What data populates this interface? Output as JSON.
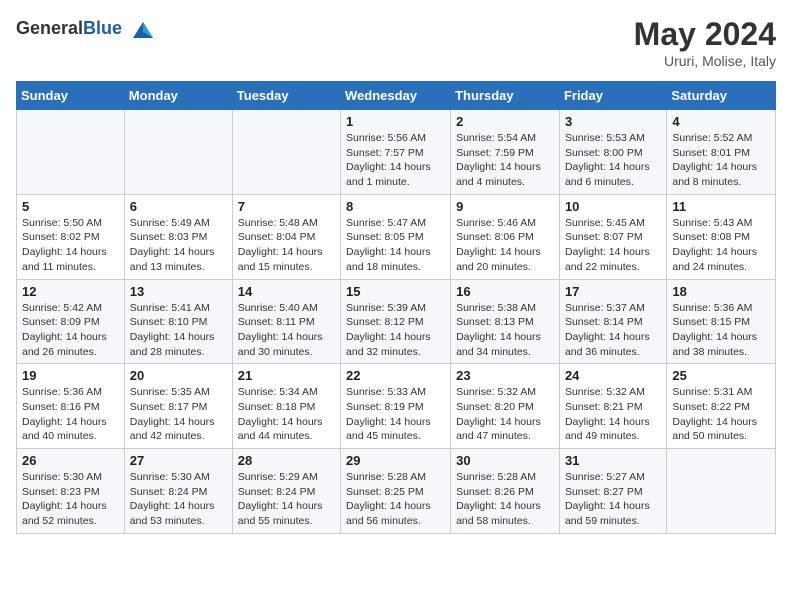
{
  "header": {
    "logo_general": "General",
    "logo_blue": "Blue",
    "month_year": "May 2024",
    "location": "Ururi, Molise, Italy"
  },
  "weekdays": [
    "Sunday",
    "Monday",
    "Tuesday",
    "Wednesday",
    "Thursday",
    "Friday",
    "Saturday"
  ],
  "weeks": [
    [
      {
        "day": "",
        "sunrise": "",
        "sunset": "",
        "daylight": ""
      },
      {
        "day": "",
        "sunrise": "",
        "sunset": "",
        "daylight": ""
      },
      {
        "day": "",
        "sunrise": "",
        "sunset": "",
        "daylight": ""
      },
      {
        "day": "1",
        "sunrise": "Sunrise: 5:56 AM",
        "sunset": "Sunset: 7:57 PM",
        "daylight": "Daylight: 14 hours and 1 minute."
      },
      {
        "day": "2",
        "sunrise": "Sunrise: 5:54 AM",
        "sunset": "Sunset: 7:59 PM",
        "daylight": "Daylight: 14 hours and 4 minutes."
      },
      {
        "day": "3",
        "sunrise": "Sunrise: 5:53 AM",
        "sunset": "Sunset: 8:00 PM",
        "daylight": "Daylight: 14 hours and 6 minutes."
      },
      {
        "day": "4",
        "sunrise": "Sunrise: 5:52 AM",
        "sunset": "Sunset: 8:01 PM",
        "daylight": "Daylight: 14 hours and 8 minutes."
      }
    ],
    [
      {
        "day": "5",
        "sunrise": "Sunrise: 5:50 AM",
        "sunset": "Sunset: 8:02 PM",
        "daylight": "Daylight: 14 hours and 11 minutes."
      },
      {
        "day": "6",
        "sunrise": "Sunrise: 5:49 AM",
        "sunset": "Sunset: 8:03 PM",
        "daylight": "Daylight: 14 hours and 13 minutes."
      },
      {
        "day": "7",
        "sunrise": "Sunrise: 5:48 AM",
        "sunset": "Sunset: 8:04 PM",
        "daylight": "Daylight: 14 hours and 15 minutes."
      },
      {
        "day": "8",
        "sunrise": "Sunrise: 5:47 AM",
        "sunset": "Sunset: 8:05 PM",
        "daylight": "Daylight: 14 hours and 18 minutes."
      },
      {
        "day": "9",
        "sunrise": "Sunrise: 5:46 AM",
        "sunset": "Sunset: 8:06 PM",
        "daylight": "Daylight: 14 hours and 20 minutes."
      },
      {
        "day": "10",
        "sunrise": "Sunrise: 5:45 AM",
        "sunset": "Sunset: 8:07 PM",
        "daylight": "Daylight: 14 hours and 22 minutes."
      },
      {
        "day": "11",
        "sunrise": "Sunrise: 5:43 AM",
        "sunset": "Sunset: 8:08 PM",
        "daylight": "Daylight: 14 hours and 24 minutes."
      }
    ],
    [
      {
        "day": "12",
        "sunrise": "Sunrise: 5:42 AM",
        "sunset": "Sunset: 8:09 PM",
        "daylight": "Daylight: 14 hours and 26 minutes."
      },
      {
        "day": "13",
        "sunrise": "Sunrise: 5:41 AM",
        "sunset": "Sunset: 8:10 PM",
        "daylight": "Daylight: 14 hours and 28 minutes."
      },
      {
        "day": "14",
        "sunrise": "Sunrise: 5:40 AM",
        "sunset": "Sunset: 8:11 PM",
        "daylight": "Daylight: 14 hours and 30 minutes."
      },
      {
        "day": "15",
        "sunrise": "Sunrise: 5:39 AM",
        "sunset": "Sunset: 8:12 PM",
        "daylight": "Daylight: 14 hours and 32 minutes."
      },
      {
        "day": "16",
        "sunrise": "Sunrise: 5:38 AM",
        "sunset": "Sunset: 8:13 PM",
        "daylight": "Daylight: 14 hours and 34 minutes."
      },
      {
        "day": "17",
        "sunrise": "Sunrise: 5:37 AM",
        "sunset": "Sunset: 8:14 PM",
        "daylight": "Daylight: 14 hours and 36 minutes."
      },
      {
        "day": "18",
        "sunrise": "Sunrise: 5:36 AM",
        "sunset": "Sunset: 8:15 PM",
        "daylight": "Daylight: 14 hours and 38 minutes."
      }
    ],
    [
      {
        "day": "19",
        "sunrise": "Sunrise: 5:36 AM",
        "sunset": "Sunset: 8:16 PM",
        "daylight": "Daylight: 14 hours and 40 minutes."
      },
      {
        "day": "20",
        "sunrise": "Sunrise: 5:35 AM",
        "sunset": "Sunset: 8:17 PM",
        "daylight": "Daylight: 14 hours and 42 minutes."
      },
      {
        "day": "21",
        "sunrise": "Sunrise: 5:34 AM",
        "sunset": "Sunset: 8:18 PM",
        "daylight": "Daylight: 14 hours and 44 minutes."
      },
      {
        "day": "22",
        "sunrise": "Sunrise: 5:33 AM",
        "sunset": "Sunset: 8:19 PM",
        "daylight": "Daylight: 14 hours and 45 minutes."
      },
      {
        "day": "23",
        "sunrise": "Sunrise: 5:32 AM",
        "sunset": "Sunset: 8:20 PM",
        "daylight": "Daylight: 14 hours and 47 minutes."
      },
      {
        "day": "24",
        "sunrise": "Sunrise: 5:32 AM",
        "sunset": "Sunset: 8:21 PM",
        "daylight": "Daylight: 14 hours and 49 minutes."
      },
      {
        "day": "25",
        "sunrise": "Sunrise: 5:31 AM",
        "sunset": "Sunset: 8:22 PM",
        "daylight": "Daylight: 14 hours and 50 minutes."
      }
    ],
    [
      {
        "day": "26",
        "sunrise": "Sunrise: 5:30 AM",
        "sunset": "Sunset: 8:23 PM",
        "daylight": "Daylight: 14 hours and 52 minutes."
      },
      {
        "day": "27",
        "sunrise": "Sunrise: 5:30 AM",
        "sunset": "Sunset: 8:24 PM",
        "daylight": "Daylight: 14 hours and 53 minutes."
      },
      {
        "day": "28",
        "sunrise": "Sunrise: 5:29 AM",
        "sunset": "Sunset: 8:24 PM",
        "daylight": "Daylight: 14 hours and 55 minutes."
      },
      {
        "day": "29",
        "sunrise": "Sunrise: 5:28 AM",
        "sunset": "Sunset: 8:25 PM",
        "daylight": "Daylight: 14 hours and 56 minutes."
      },
      {
        "day": "30",
        "sunrise": "Sunrise: 5:28 AM",
        "sunset": "Sunset: 8:26 PM",
        "daylight": "Daylight: 14 hours and 58 minutes."
      },
      {
        "day": "31",
        "sunrise": "Sunrise: 5:27 AM",
        "sunset": "Sunset: 8:27 PM",
        "daylight": "Daylight: 14 hours and 59 minutes."
      },
      {
        "day": "",
        "sunrise": "",
        "sunset": "",
        "daylight": ""
      }
    ]
  ]
}
